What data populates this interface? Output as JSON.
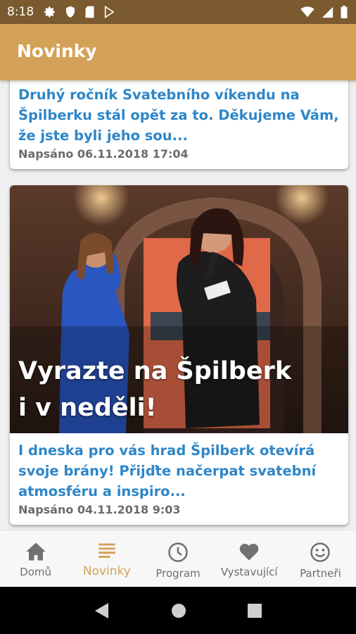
{
  "status_bar": {
    "time": "8:18",
    "left_icons": [
      "gear-icon",
      "shield-icon",
      "sd-card-icon",
      "play-store-icon"
    ],
    "right_icons": [
      "wifi-icon",
      "signal-icon",
      "battery-icon"
    ]
  },
  "app_bar": {
    "title": "Novinky"
  },
  "articles": [
    {
      "excerpt": "Druhý ročník Svatebního víkendu na Špilberku stál opět za to. Děkujeme Vám, že jste byli jeho sou...",
      "date": "Napsáno 06.11.2018 17:04"
    },
    {
      "image_title": "Vyrazte na Špilberk i v neděli!",
      "excerpt": "I dneska pro vás hrad Špilberk otevírá svoje brány! Přijďte načerpat svatební atmosféru a inspiro...",
      "date": "Napsáno 04.11.2018 9:03"
    }
  ],
  "bottom_nav": {
    "items": [
      {
        "label": "Domů",
        "icon": "home-icon",
        "active": false
      },
      {
        "label": "Novinky",
        "icon": "list-icon",
        "active": true
      },
      {
        "label": "Program",
        "icon": "clock-icon",
        "active": false
      },
      {
        "label": "Vystavující",
        "icon": "heart-icon",
        "active": false
      },
      {
        "label": "Partneři",
        "icon": "smiley-icon",
        "active": false
      }
    ]
  },
  "system_nav": [
    "back-icon",
    "home-circle-icon",
    "recents-icon"
  ],
  "colors": {
    "accent": "#d4a158",
    "status_bar": "#7a5a2e",
    "link": "#2e86c8",
    "date": "#6b6b6b"
  }
}
